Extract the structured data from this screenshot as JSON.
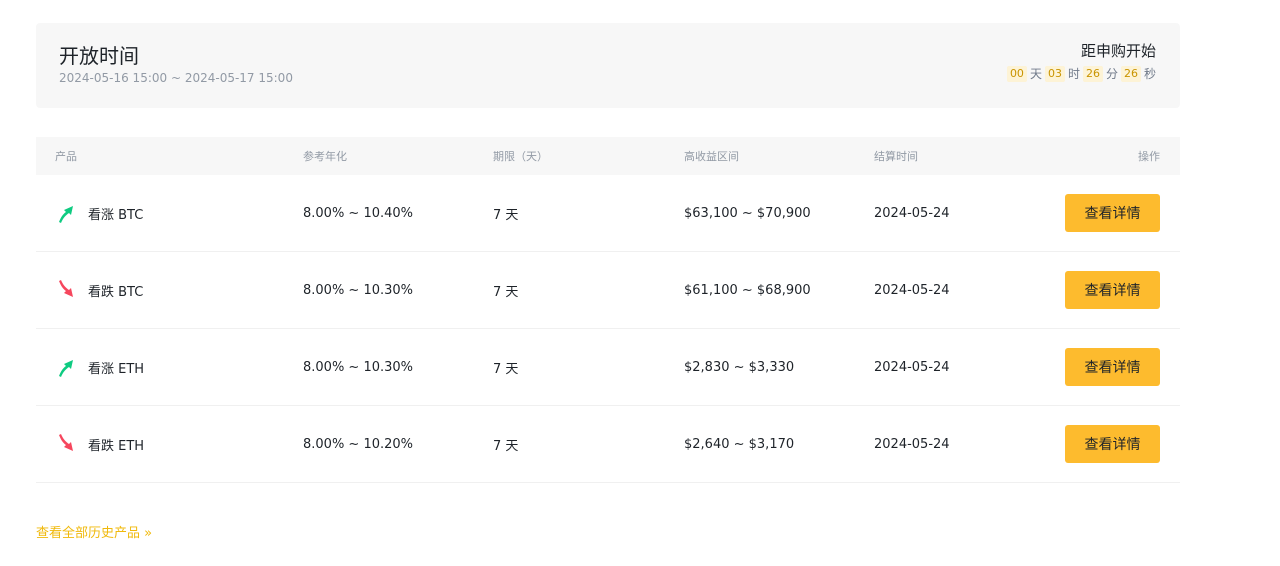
{
  "open_panel": {
    "title": "开放时间",
    "range": "2024-05-16 15:00 ~ 2024-05-17 15:00",
    "countdown_label": "距申购开始",
    "countdown": [
      {
        "value": "00",
        "unit": "天"
      },
      {
        "value": "03",
        "unit": "时"
      },
      {
        "value": "26",
        "unit": "分"
      },
      {
        "value": "26",
        "unit": "秒"
      }
    ]
  },
  "table": {
    "headers": [
      "产品",
      "参考年化",
      "期限（天）",
      "高收益区间",
      "结算时间",
      "操作"
    ],
    "rows": [
      {
        "direction": "up",
        "product": "看涨 BTC",
        "apr": "8.00% ~ 10.40%",
        "term": "7 天",
        "range": "$63,100 ~ $70,900",
        "settle": "2024-05-24",
        "action": "查看详情"
      },
      {
        "direction": "down",
        "product": "看跌 BTC",
        "apr": "8.00% ~ 10.30%",
        "term": "7 天",
        "range": "$61,100 ~ $68,900",
        "settle": "2024-05-24",
        "action": "查看详情"
      },
      {
        "direction": "up",
        "product": "看涨 ETH",
        "apr": "8.00% ~ 10.30%",
        "term": "7 天",
        "range": "$2,830 ~ $3,330",
        "settle": "2024-05-24",
        "action": "查看详情"
      },
      {
        "direction": "down",
        "product": "看跌 ETH",
        "apr": "8.00% ~ 10.20%",
        "term": "7 天",
        "range": "$2,640 ~ $3,170",
        "settle": "2024-05-24",
        "action": "查看详情"
      }
    ]
  },
  "history_link": "查看全部历史产品 »",
  "colors": {
    "up": "#0ecb81",
    "down": "#f6465d",
    "accent": "#fdbb2e",
    "link": "#f0b90b"
  }
}
